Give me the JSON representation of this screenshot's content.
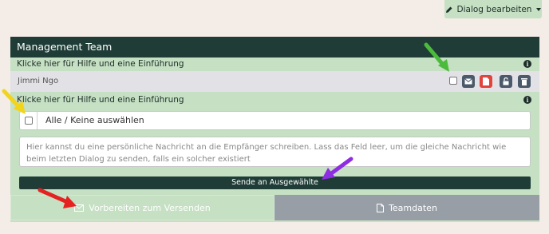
{
  "toolbar": {
    "dialog_edit_label": "Dialog bearbeiten"
  },
  "panel": {
    "title": "Management Team",
    "help_text": "Klicke hier für Hilfe und eine Einführung",
    "member": {
      "name": "Jimmi Ngo",
      "actions": [
        "envelope-icon",
        "document-icon",
        "unlock-icon",
        "trash-icon"
      ]
    },
    "help_text_2": "Klicke hier für Hilfe und eine Einführung",
    "select_all_label": "Alle / Keine auswählen",
    "message_placeholder": "Hier kannst du eine persönliche Nachricht an die Empfänger schreiben. Lass das Feld leer, um die gleiche Nachricht wie beim letzten Dialog zu senden, falls ein solcher existiert",
    "send_selected_label": "Sende an Ausgewählte"
  },
  "footer": {
    "prepare_label": "Vorbereiten zum Versenden",
    "team_data_label": "Teamdaten"
  },
  "colors": {
    "header_bg": "#1f3d36",
    "panel_bg": "#c5e0c3",
    "delete_red": "#e0443c",
    "footer_gray": "#979ea6"
  },
  "annotations": [
    "green-arrow-icon",
    "yellow-arrow-icon",
    "purple-arrow-icon",
    "red-arrow-icon"
  ]
}
